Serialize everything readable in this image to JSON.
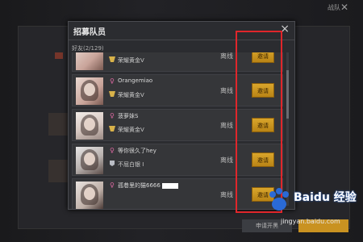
{
  "background": {
    "top_right_label": "战队",
    "bottom_button_label": "申请开黑"
  },
  "dialog": {
    "title": "招募队员",
    "close_label": "×",
    "friends_count": "好友(2/129)"
  },
  "friends": [
    {
      "name": "",
      "rank": "荣耀黄金V",
      "status": "离线",
      "invite": "邀请"
    },
    {
      "name": "Orangemiao",
      "rank": "荣耀黄金V",
      "status": "离线",
      "invite": "邀请"
    },
    {
      "name": "菠萝妹S",
      "rank": "荣耀黄金V",
      "status": "离线",
      "invite": "邀请"
    },
    {
      "name": "等你很久了hey",
      "rank": "不屈白银 I",
      "status": "离线",
      "invite": "邀请"
    },
    {
      "name": "孤巷里的猫6666",
      "rank": "",
      "status": "离线",
      "invite": "邀请"
    }
  ],
  "watermark": {
    "brand": "Baidu 经验",
    "url": "jingyan.baidu.com"
  },
  "colors": {
    "accent_gold": "#c99221",
    "highlight_red": "#e0262b",
    "female_pink": "#e06aa3"
  }
}
